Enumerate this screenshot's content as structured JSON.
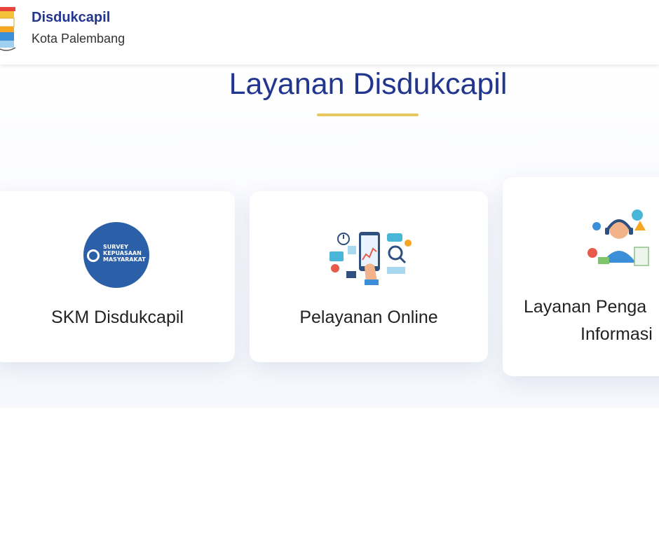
{
  "header": {
    "title": "Disdukcapil",
    "subtitle": "Kota Palembang",
    "logo_icon": "palembang-city-emblem"
  },
  "section": {
    "title": "Layanan Disdukcapil",
    "underline_color": "#e7c75f"
  },
  "cards": [
    {
      "label": "SKM Disdukcapil",
      "icon": "survey-kepuasan-masyarakat-badge",
      "badge_lines": [
        "SURVEY",
        "KEPUASAAN",
        "MASYARAKAT"
      ]
    },
    {
      "label": "Pelayanan Online",
      "icon": "online-service-illustration"
    },
    {
      "label_line1": "Layanan Penga",
      "label_line2": "Informasi",
      "icon": "customer-service-illustration"
    }
  ],
  "colors": {
    "primary": "#22358f",
    "accent": "#e7c75f",
    "badge_blue": "#2b5fa8",
    "text": "#222222"
  }
}
